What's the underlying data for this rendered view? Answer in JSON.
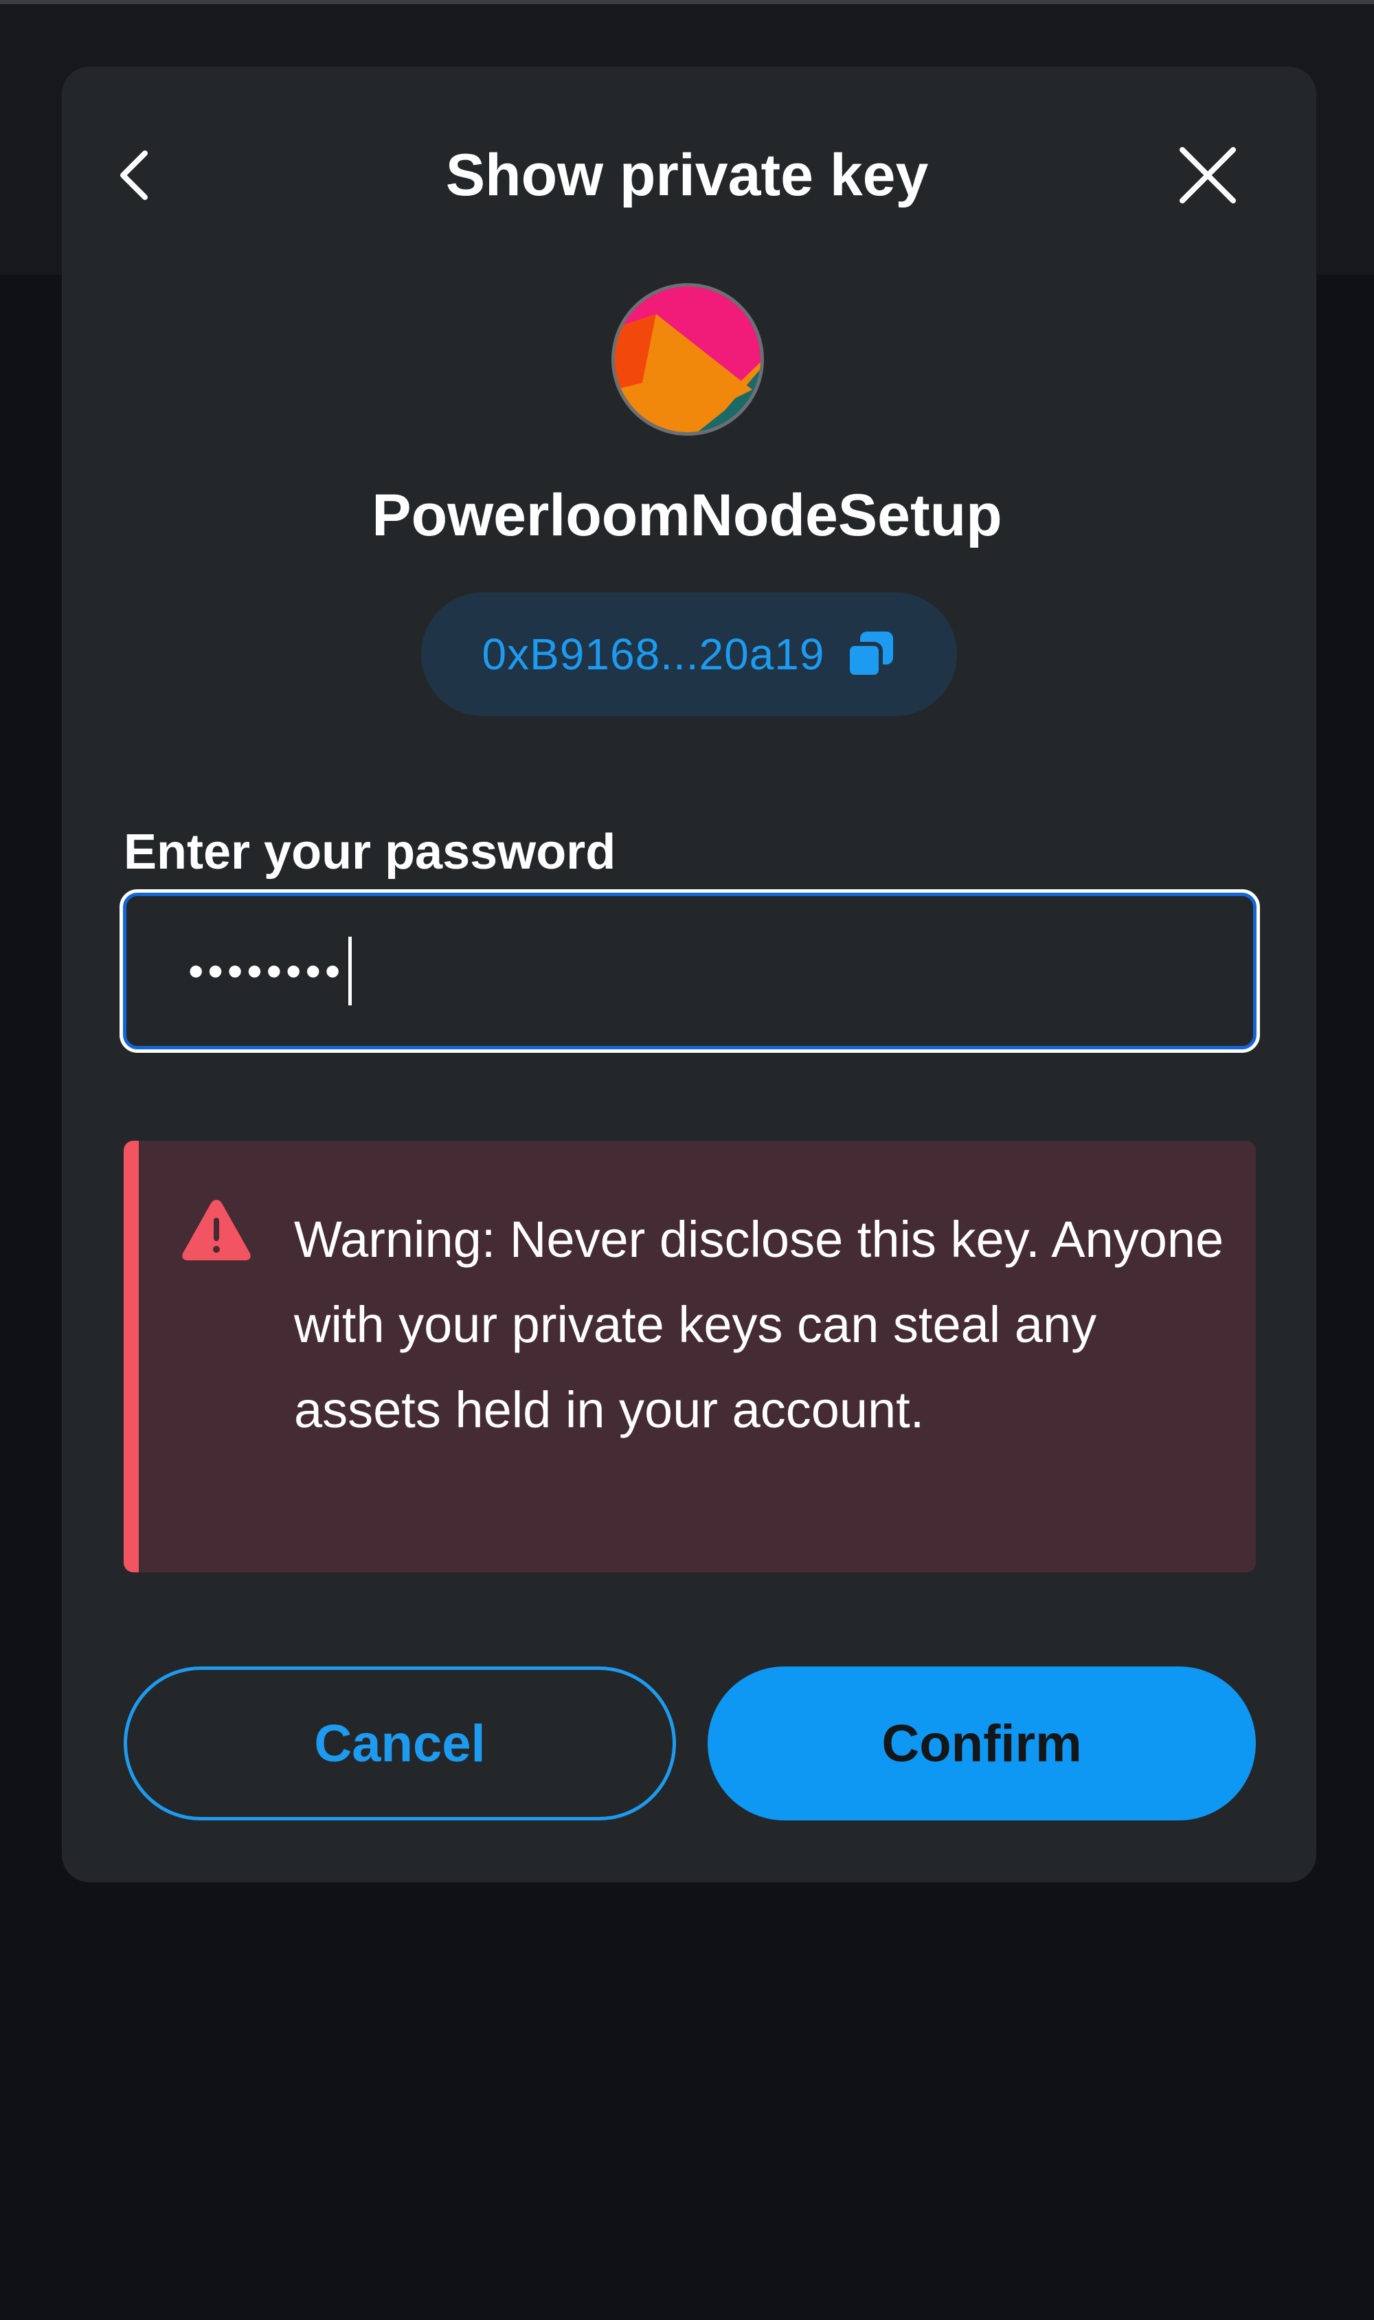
{
  "dialog": {
    "title": "Show private key",
    "back_icon": "chevron-left-icon",
    "close_icon": "close-icon"
  },
  "account": {
    "avatar_icon": "jazzicon-avatar",
    "name": "PowerloomNodeSetup",
    "address_short": "0xB9168...20a19",
    "copy_icon": "copy-icon"
  },
  "password": {
    "label": "Enter your password",
    "masked_value": "••••••••"
  },
  "warning": {
    "icon": "warning-triangle-icon",
    "text": "Warning: Never disclose this key. Anyone with your private keys can steal any assets held in your account."
  },
  "buttons": {
    "cancel_label": "Cancel",
    "confirm_label": "Confirm"
  },
  "colors": {
    "modal_background": "#24272a",
    "accent_blue": "#1d9bf0",
    "warning_red": "#f25462",
    "warning_background": "#452b33"
  }
}
